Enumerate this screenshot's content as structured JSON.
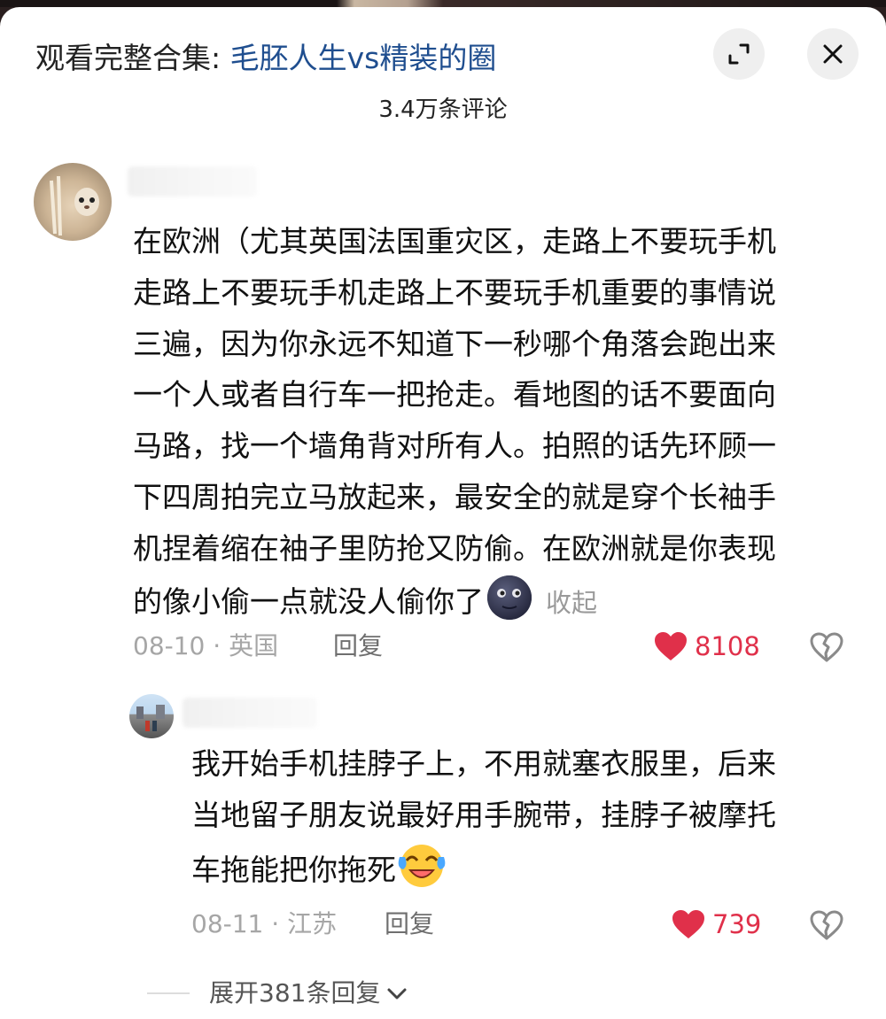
{
  "header": {
    "prefix": "观看完整合集: ",
    "collection_title": "毛胚人生vs精装的圈",
    "comment_count": "3.4万条评论"
  },
  "icons": {
    "expand": "expand-arrows-icon",
    "close": "close-icon",
    "like": "heart-icon",
    "dislike": "broken-heart-icon",
    "chevron": "chevron-down-icon"
  },
  "colors": {
    "link": "#1f4e8f",
    "like": "#e0304a",
    "meta": "#a6a6a6"
  },
  "comments": [
    {
      "lines": [
        "在欧洲（尤其英国法国重灾区，走路上不要玩手机",
        "走路上不要玩手机走路上不要玩手机重要的事情说",
        "三遍，因为你永远不知道下一秒哪个角落会跑出来",
        "一个人或者自行车一把抢走。看地图的话不要面向",
        "马路，找一个墙角背对所有人。拍照的话先环顾一",
        "下四周拍完立马放起来，最安全的就是穿个长袖手",
        "机捏着缩在袖子里防抢又防偷。在欧洲就是你表现",
        "的像小偷一点就没人偷你了"
      ],
      "emoji": "new-moon-face-emoji",
      "collapse_label": "收起",
      "date": "08-10",
      "location": "英国",
      "reply_label": "回复",
      "likes": "8108"
    },
    {
      "lines": [
        "我开始手机挂脖子上，不用就塞衣服里，后来",
        "当地留子朋友说最好用手腕带，挂脖子被摩托",
        "车拖能把你拖死"
      ],
      "emoji": "laughing-crying-emoji",
      "date": "08-11",
      "location": "江苏",
      "reply_label": "回复",
      "likes": "739"
    }
  ],
  "expand_replies": "展开381条回复"
}
